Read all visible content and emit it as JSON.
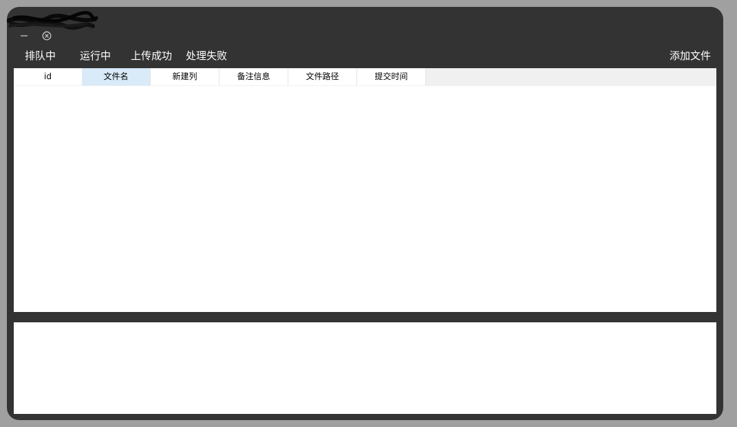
{
  "window": {
    "controls": {
      "minimize": "−",
      "close_icon": "circle-x-icon"
    }
  },
  "tabs": [
    {
      "label": "排队中"
    },
    {
      "label": "运行中"
    },
    {
      "label": "上传成功"
    },
    {
      "label": "处理失败"
    }
  ],
  "toolbar": {
    "add_file_label": "添加文件"
  },
  "grid": {
    "columns": [
      {
        "label": "id"
      },
      {
        "label": "文件名"
      },
      {
        "label": "新建列"
      },
      {
        "label": "备注信息"
      },
      {
        "label": "文件路径"
      },
      {
        "label": "提交时间"
      }
    ],
    "selected_column": "文件名",
    "rows": []
  },
  "colors": {
    "window_bg": "#333333",
    "outer_bg": "#a0a0a0",
    "selected_header": "#d9eaf8"
  }
}
